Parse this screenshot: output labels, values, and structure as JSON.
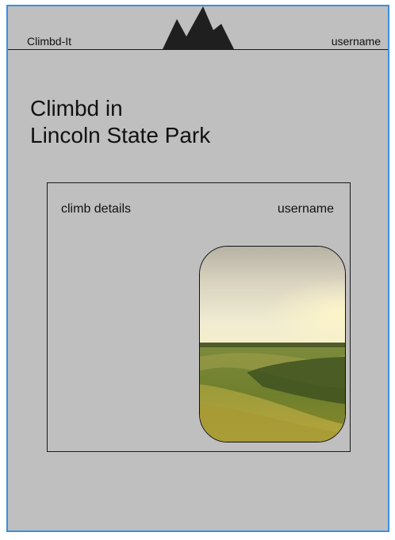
{
  "header": {
    "brand": "Climbd-It",
    "username": "username",
    "logo_icon": "mountain-icon"
  },
  "page": {
    "title_line1": "Climbd in",
    "title_line2": "Lincoln State Park"
  },
  "card": {
    "title": "climb details",
    "username": "username",
    "image_description_icon": "landscape-photo"
  },
  "colors": {
    "background": "#bfbfbf",
    "frame_border": "#3b8ee0",
    "text": "#111111"
  }
}
